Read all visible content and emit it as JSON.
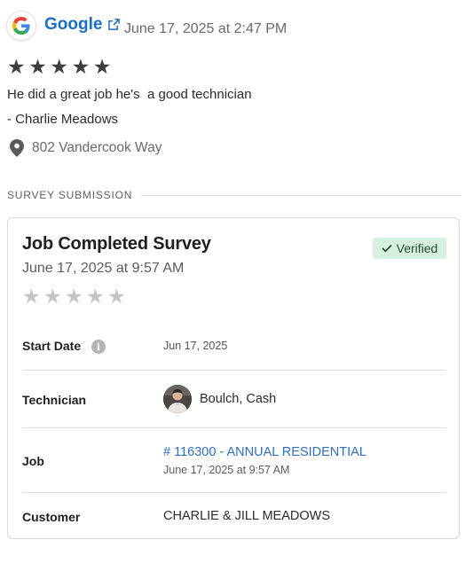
{
  "review": {
    "source": "Google",
    "source_icon": "google-g-logo",
    "date": "June 17, 2025 at 2:47 PM",
    "rating": 5,
    "max_rating": 5,
    "text": "He did a great job he's  a good technician",
    "author": "- Charlie Meadows",
    "address": "802 Vandercook Way"
  },
  "section": {
    "label": "SURVEY SUBMISSION"
  },
  "survey": {
    "title": "Job Completed Survey",
    "date": "June 17, 2025 at 9:57 AM",
    "badge": "Verified",
    "rating": 0,
    "max_rating": 5,
    "fields": {
      "start_date_label": "Start Date",
      "start_date_value": "Jun 17, 2025",
      "technician_label": "Technician",
      "technician_name": "Boulch, Cash",
      "job_label": "Job",
      "job_link": "# 116300 - ANNUAL RESIDENTIAL",
      "job_date": "June 17, 2025 at 9:57 AM",
      "customer_label": "Customer",
      "customer_value": "CHARLIE & JILL MEADOWS"
    }
  },
  "colors": {
    "link_blue": "#1a6fc0",
    "star_filled": "#3d3d3d",
    "star_empty": "#c4c4c4",
    "verified_bg": "#d7f1e0"
  },
  "icons": [
    "google-g-logo",
    "external-link-icon",
    "star-icon",
    "map-pin-icon",
    "info-icon",
    "check-icon"
  ]
}
